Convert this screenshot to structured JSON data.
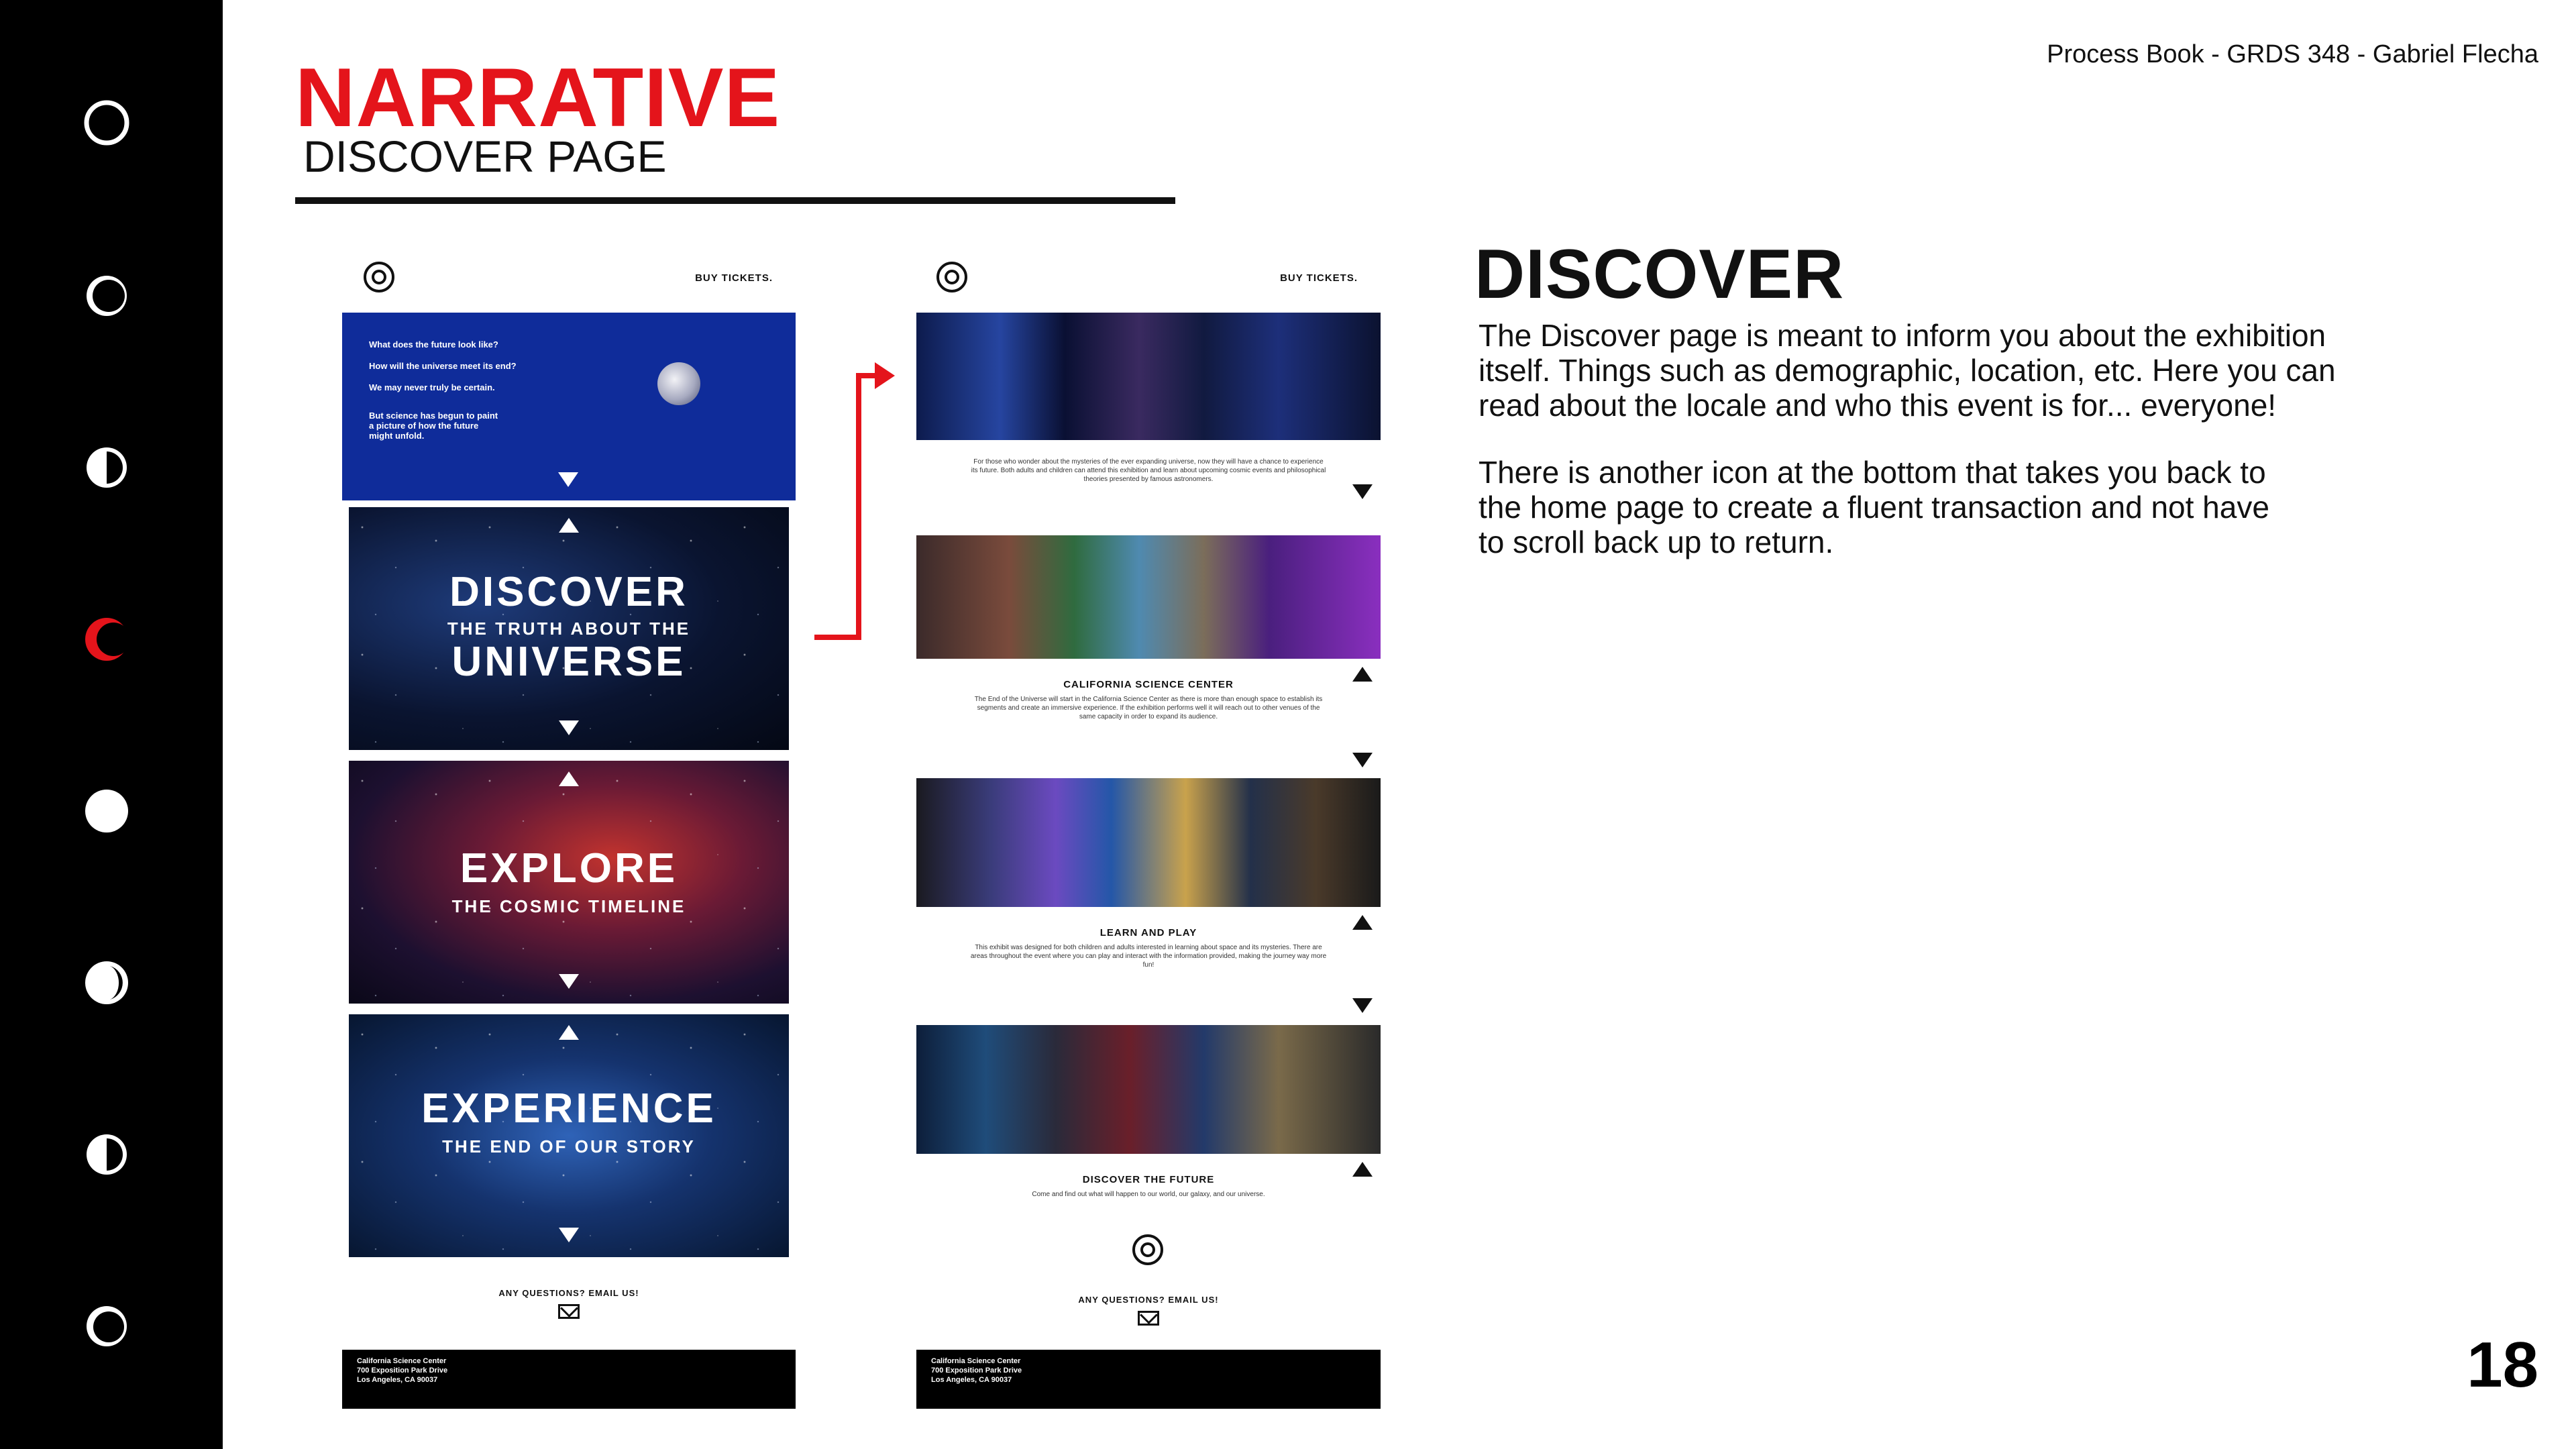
{
  "header": {
    "meta": "Process Book - GRDS 348 - Gabriel Flecha",
    "title": "NARRATIVE",
    "subtitle": "DISCOVER PAGE",
    "page_number": "18"
  },
  "sidebar": {
    "icons": [
      "moon-new-icon",
      "moon-waxing-crescent-icon",
      "moon-first-quarter-icon",
      "moon-crescent-active-icon",
      "moon-full-icon",
      "moon-waning-gibbous-icon",
      "moon-last-quarter-icon",
      "moon-waning-crescent-icon"
    ],
    "active_color": "#e4141b"
  },
  "description": {
    "heading": "DISCOVER",
    "lines_1": [
      "The Discover page is meant to inform you about the exhibition",
      "itself. Things such as demographic, location, etc. Here you can",
      "read about the locale and who this event is for... everyone!"
    ],
    "lines_2": [
      "There is another icon at the bottom that takes you back to",
      "the home page to create a fluent transaction and not have",
      "to scroll back up to return."
    ]
  },
  "left_mockup": {
    "buy": "BUY TICKETS.",
    "intro": [
      "What does the future look like?",
      "How will the universe meet its end?",
      "We may never truly be certain.",
      "But science has begun to paint",
      "a picture of how the future",
      "might unfold."
    ],
    "discover": {
      "line1": "DISCOVER",
      "line2": "THE TRUTH ABOUT THE",
      "line3": "UNIVERSE"
    },
    "explore": {
      "line1": "EXPLORE",
      "line2": "THE COSMIC TIMELINE"
    },
    "experience": {
      "line1": "EXPERIENCE",
      "line2": "THE END OF OUR STORY"
    },
    "ask": "ANY QUESTIONS? EMAIL US!",
    "footer": [
      "California Science Center",
      "700 Exposition Park Drive",
      "Los Angeles, CA 90037"
    ]
  },
  "right_mockup": {
    "buy": "BUY TICKETS.",
    "intro_text": "For those who wonder about the mysteries of the ever expanding universe, now they will have a chance to experience its future. Both adults and children can attend this exhibition and learn about upcoming cosmic events and philosophical theories presented by famous astronomers.",
    "sections": [
      {
        "title": "CALIFORNIA SCIENCE CENTER",
        "text": "The End of the Universe will start in the California Science Center as there is more than enough space to establish its segments and create an immersive experience. If the exhibition performs well it will reach out to other venues of the same capacity in order to expand its audience."
      },
      {
        "title": "LEARN AND PLAY",
        "text": "This exhibit was designed for both children and adults interested in learning about space and its mysteries. There are areas throughout the event where you can play and interact with the information provided, making the journey way more fun!"
      },
      {
        "title": "DISCOVER THE FUTURE",
        "text": "Come and find out what will happen to our world, our galaxy, and our universe."
      }
    ],
    "ask": "ANY QUESTIONS? EMAIL US!",
    "footer": [
      "California Science Center",
      "700 Exposition Park Drive",
      "Los Angeles, CA 90037"
    ]
  },
  "colors": {
    "accent": "#e4141b",
    "rail": "#000000"
  }
}
